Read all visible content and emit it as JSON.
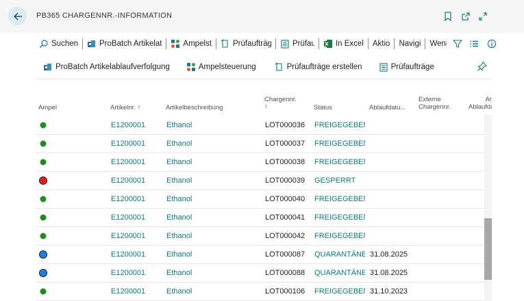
{
  "header": {
    "title": "PB365 CHARGENNR.-INFORMATION",
    "icons": [
      "back-arrow-icon",
      "bookmark-icon",
      "open-in-new-icon",
      "expand-icon"
    ]
  },
  "toolbar1": {
    "search_label": "Suchen",
    "probatch_label": "ProBatch Artikelat",
    "ampel_label": "Ampelst",
    "pruefauftraege_label": "Prüfaufträg",
    "pruefau_label": "Prüfau",
    "excel_label": "In Excel",
    "aktio_label": "Aktio",
    "navigi_label": "Navigi",
    "weni_label": "Weni"
  },
  "toolbar2": {
    "probatch_label": "ProBatch Artikelablaufverfolgung",
    "ampel_label": "Ampelsteuerung",
    "create_label": "Prüfaufträge erstellen",
    "pruef_label": "Prüfaufträge"
  },
  "columns": {
    "ampel": "Ampel",
    "artikelnr": "Artikelnr.",
    "sort_arrow": "↑",
    "beschreibung": "Artikelbeschreibung",
    "charge": "Chargennr.",
    "status": "Status",
    "ablauf": "Ablaufdatu...",
    "ext1": "Externe",
    "ext2": "Chargennr.",
    "abl2_line1": "Ar",
    "abl2_line2": "Ablaufda"
  },
  "colors": {
    "green": "#238a23",
    "red": "#ee1c1c",
    "blue": "#1e7fe0",
    "teal_link": "#0e7a7a",
    "accent": "#0e7a7a"
  },
  "rows": [
    {
      "ampel": "green",
      "artikelnr": "E1200001",
      "beschreibung": "Ethanol",
      "charge": "LOT000036",
      "status": "FREIGEGEBEN",
      "ablauf": ""
    },
    {
      "ampel": "green",
      "artikelnr": "E1200001",
      "beschreibung": "Ethanol",
      "charge": "LOT000037",
      "status": "FREIGEGEBEN",
      "ablauf": ""
    },
    {
      "ampel": "green",
      "artikelnr": "E1200001",
      "beschreibung": "Ethanol",
      "charge": "LOT000038",
      "status": "FREIGEGEBEN",
      "ablauf": ""
    },
    {
      "ampel": "red",
      "artikelnr": "E1200001",
      "beschreibung": "Ethanol",
      "charge": "LOT000039",
      "status": "GESPERRT",
      "ablauf": ""
    },
    {
      "ampel": "green",
      "artikelnr": "E1200001",
      "beschreibung": "Ethanol",
      "charge": "LOT000040",
      "status": "FREIGEGEBEN",
      "ablauf": ""
    },
    {
      "ampel": "green",
      "artikelnr": "E1200001",
      "beschreibung": "Ethanol",
      "charge": "LOT000041",
      "status": "FREIGEGEBEN",
      "ablauf": ""
    },
    {
      "ampel": "green",
      "artikelnr": "E1200001",
      "beschreibung": "Ethanol",
      "charge": "LOT000042",
      "status": "FREIGEGEBEN",
      "ablauf": ""
    },
    {
      "ampel": "blue",
      "artikelnr": "E1200001",
      "beschreibung": "Ethanol",
      "charge": "LOT000087",
      "status": "QUARANTÄNE",
      "ablauf": "31.08.2025"
    },
    {
      "ampel": "blue",
      "artikelnr": "E1200001",
      "beschreibung": "Ethanol",
      "charge": "LOT000088",
      "status": "QUARANTÄNE",
      "ablauf": "31.08.2025"
    },
    {
      "ampel": "green",
      "artikelnr": "E1200001",
      "beschreibung": "Ethanol",
      "charge": "LOT000106",
      "status": "FREIGEGEBEN",
      "ablauf": "31.10.2023"
    }
  ]
}
